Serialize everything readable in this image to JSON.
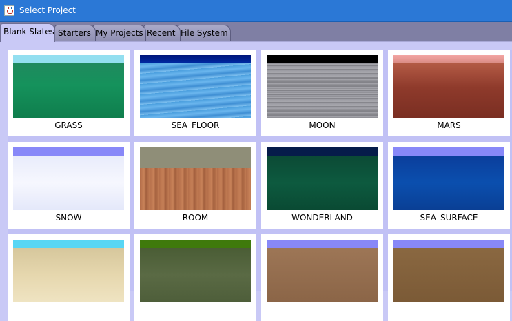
{
  "window": {
    "title": "Select Project"
  },
  "tabs": [
    {
      "label": "Blank Slates"
    },
    {
      "label": "Starters"
    },
    {
      "label": "My Projects"
    },
    {
      "label": "Recent"
    },
    {
      "label": "File System"
    }
  ],
  "templates": [
    {
      "label": "GRASS"
    },
    {
      "label": "SEA_FLOOR"
    },
    {
      "label": "MOON"
    },
    {
      "label": "MARS"
    },
    {
      "label": "SNOW"
    },
    {
      "label": "ROOM"
    },
    {
      "label": "WONDERLAND"
    },
    {
      "label": "SEA_SURFACE"
    },
    {
      "label": ""
    },
    {
      "label": ""
    },
    {
      "label": ""
    },
    {
      "label": ""
    }
  ]
}
